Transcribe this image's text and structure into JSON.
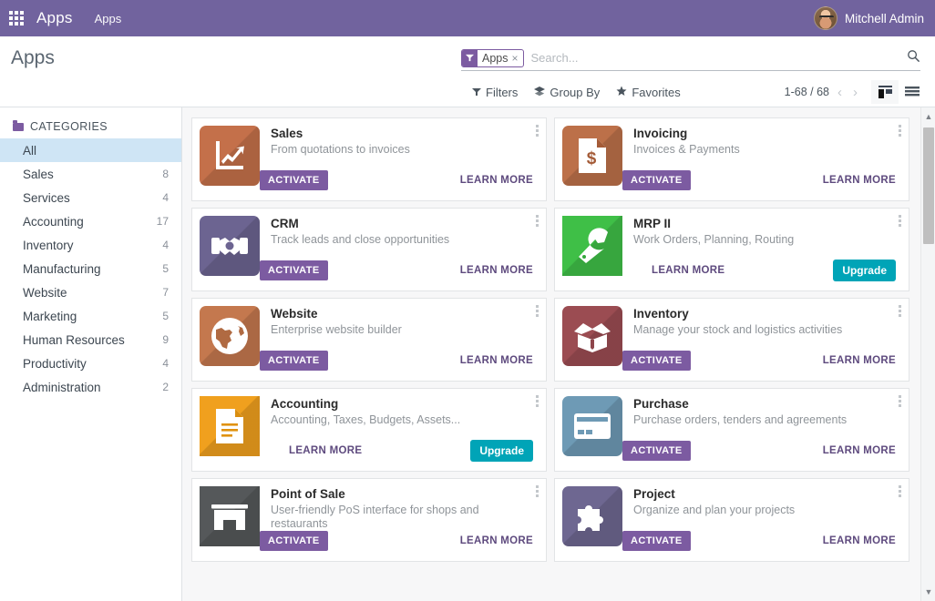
{
  "navbar": {
    "apps_icon": "grid-icon",
    "brand": "Apps",
    "menu_item": "Apps",
    "user_name": "Mitchell Admin",
    "color": "#71639e"
  },
  "control_panel": {
    "title": "Apps",
    "search": {
      "facet_label": "Apps",
      "facet_icon": "filter-icon",
      "facet_close": "×",
      "placeholder": "Search...",
      "value": "",
      "magnifier_icon": "search-icon"
    },
    "filters_label": "Filters",
    "group_by_label": "Group By",
    "favorites_label": "Favorites",
    "pager": "1-68 / 68",
    "prev_icon": "chevron-left-icon",
    "next_icon": "chevron-right-icon",
    "views": [
      {
        "name": "kanban",
        "icon": "kanban-view-icon",
        "active": true
      },
      {
        "name": "list",
        "icon": "list-view-icon",
        "active": false
      }
    ]
  },
  "sidebar": {
    "header": "CATEGORIES",
    "items": [
      {
        "label": "All",
        "count": "",
        "active": true
      },
      {
        "label": "Sales",
        "count": "8",
        "active": false
      },
      {
        "label": "Services",
        "count": "4",
        "active": false
      },
      {
        "label": "Accounting",
        "count": "17",
        "active": false
      },
      {
        "label": "Inventory",
        "count": "4",
        "active": false
      },
      {
        "label": "Manufacturing",
        "count": "5",
        "active": false
      },
      {
        "label": "Website",
        "count": "7",
        "active": false
      },
      {
        "label": "Marketing",
        "count": "5",
        "active": false
      },
      {
        "label": "Human Resources",
        "count": "9",
        "active": false
      },
      {
        "label": "Productivity",
        "count": "4",
        "active": false
      },
      {
        "label": "Administration",
        "count": "2",
        "active": false
      }
    ]
  },
  "buttons": {
    "activate": "ACTIVATE",
    "learn_more": "LEARN MORE",
    "upgrade": "Upgrade",
    "activate_color": "#7c5ba1",
    "upgrade_color": "#00a4b7"
  },
  "apps": {
    "left": [
      {
        "title": "Sales",
        "description": "From quotations to invoices",
        "icon": "sales-chart-icon",
        "icon_color": "#c4704a",
        "icon_rounded": true,
        "primary": "activate"
      },
      {
        "title": "CRM",
        "description": "Track leads and close opportunities",
        "icon": "crm-handshake-icon",
        "icon_color": "#6c6491",
        "icon_rounded": true,
        "primary": "activate"
      },
      {
        "title": "Website",
        "description": "Enterprise website builder",
        "icon": "website-globe-icon",
        "icon_color": "#c4784e",
        "icon_rounded": true,
        "primary": "activate"
      },
      {
        "title": "Accounting",
        "description": "Accounting, Taxes, Budgets, Assets...",
        "icon": "accounting-document-icon",
        "icon_color": "#f0a01e",
        "icon_rounded": false,
        "primary": "upgrade"
      },
      {
        "title": "Point of Sale",
        "description": "User-friendly PoS interface for shops and restaurants",
        "icon": "pos-store-icon",
        "icon_color": "#55585a",
        "icon_rounded": false,
        "primary": "activate"
      }
    ],
    "right": [
      {
        "title": "Invoicing",
        "description": "Invoices & Payments",
        "icon": "invoicing-dollar-document-icon",
        "icon_color": "#bc7049",
        "icon_rounded": true,
        "primary": "activate"
      },
      {
        "title": "MRP II",
        "description": "Work Orders, Planning, Routing",
        "icon": "mrp-wrench-icon",
        "icon_color": "#3fbf47",
        "icon_rounded": false,
        "primary": "upgrade"
      },
      {
        "title": "Inventory",
        "description": "Manage your stock and logistics activities",
        "icon": "inventory-box-icon",
        "icon_color": "#9b4c52",
        "icon_rounded": true,
        "primary": "activate"
      },
      {
        "title": "Purchase",
        "description": "Purchase orders, tenders and agreements",
        "icon": "purchase-card-icon",
        "icon_color": "#6e9ab5",
        "icon_rounded": true,
        "primary": "activate"
      },
      {
        "title": "Project",
        "description": "Organize and plan your projects",
        "icon": "project-puzzle-icon",
        "icon_color": "#6e6791",
        "icon_rounded": true,
        "primary": "activate"
      }
    ]
  }
}
